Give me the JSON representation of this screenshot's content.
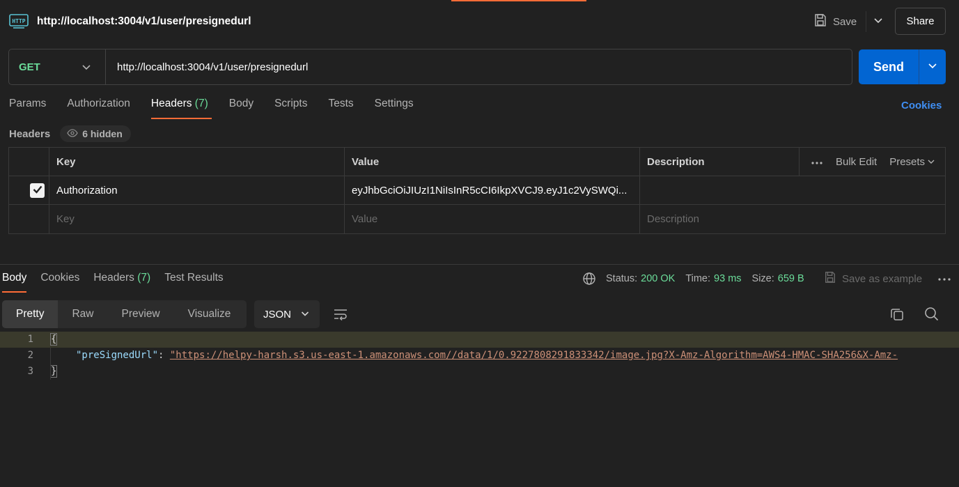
{
  "request": {
    "title": "http://localhost:3004/v1/user/presignedurl",
    "icon": "http-icon",
    "save_label": "Save",
    "share_label": "Share",
    "method": "GET",
    "url": "http://localhost:3004/v1/user/presignedurl",
    "send_label": "Send"
  },
  "request_tabs": [
    {
      "label": "Params"
    },
    {
      "label": "Authorization"
    },
    {
      "label": "Headers",
      "count": "(7)",
      "active": true
    },
    {
      "label": "Body"
    },
    {
      "label": "Scripts"
    },
    {
      "label": "Tests"
    },
    {
      "label": "Settings"
    }
  ],
  "cookies_label": "Cookies",
  "headers_section": {
    "label": "Headers",
    "hidden_label": "6 hidden"
  },
  "headers_table": {
    "columns": [
      "Key",
      "Value",
      "Description"
    ],
    "bulk_edit": "Bulk Edit",
    "presets": "Presets",
    "rows": [
      {
        "checked": true,
        "key": "Authorization",
        "value": "eyJhbGciOiJIUzI1NiIsInR5cCI6IkpXVCJ9.eyJ1c2VySWQi...",
        "description": ""
      }
    ],
    "placeholder": {
      "key": "Key",
      "value": "Value",
      "description": "Description"
    }
  },
  "response_tabs": [
    {
      "label": "Body",
      "active": true
    },
    {
      "label": "Cookies"
    },
    {
      "label": "Headers",
      "count": "(7)"
    },
    {
      "label": "Test Results"
    }
  ],
  "response_status": {
    "status_label": "Status:",
    "status_value": "200 OK",
    "time_label": "Time:",
    "time_value": "93 ms",
    "size_label": "Size:",
    "size_value": "659 B",
    "save_example": "Save as example"
  },
  "format": {
    "modes": [
      "Pretty",
      "Raw",
      "Preview",
      "Visualize"
    ],
    "active_mode": "Pretty",
    "language": "JSON"
  },
  "code": {
    "line_numbers": [
      "1",
      "2",
      "3"
    ],
    "open_brace": "{",
    "close_brace": "}",
    "key": "\"preSignedUrl\"",
    "colon": ": ",
    "value": "\"https://helpy-harsh.s3.us-east-1.amazonaws.com//data/1/0.9227808291833342/image.jpg?X-Amz-Algorithm=AWS4-HMAC-SHA256&X-Amz-"
  },
  "colors": {
    "accent": "#ff6c37",
    "send": "#0265d2",
    "success": "#6bdd9a",
    "link": "#3f8ef2"
  }
}
